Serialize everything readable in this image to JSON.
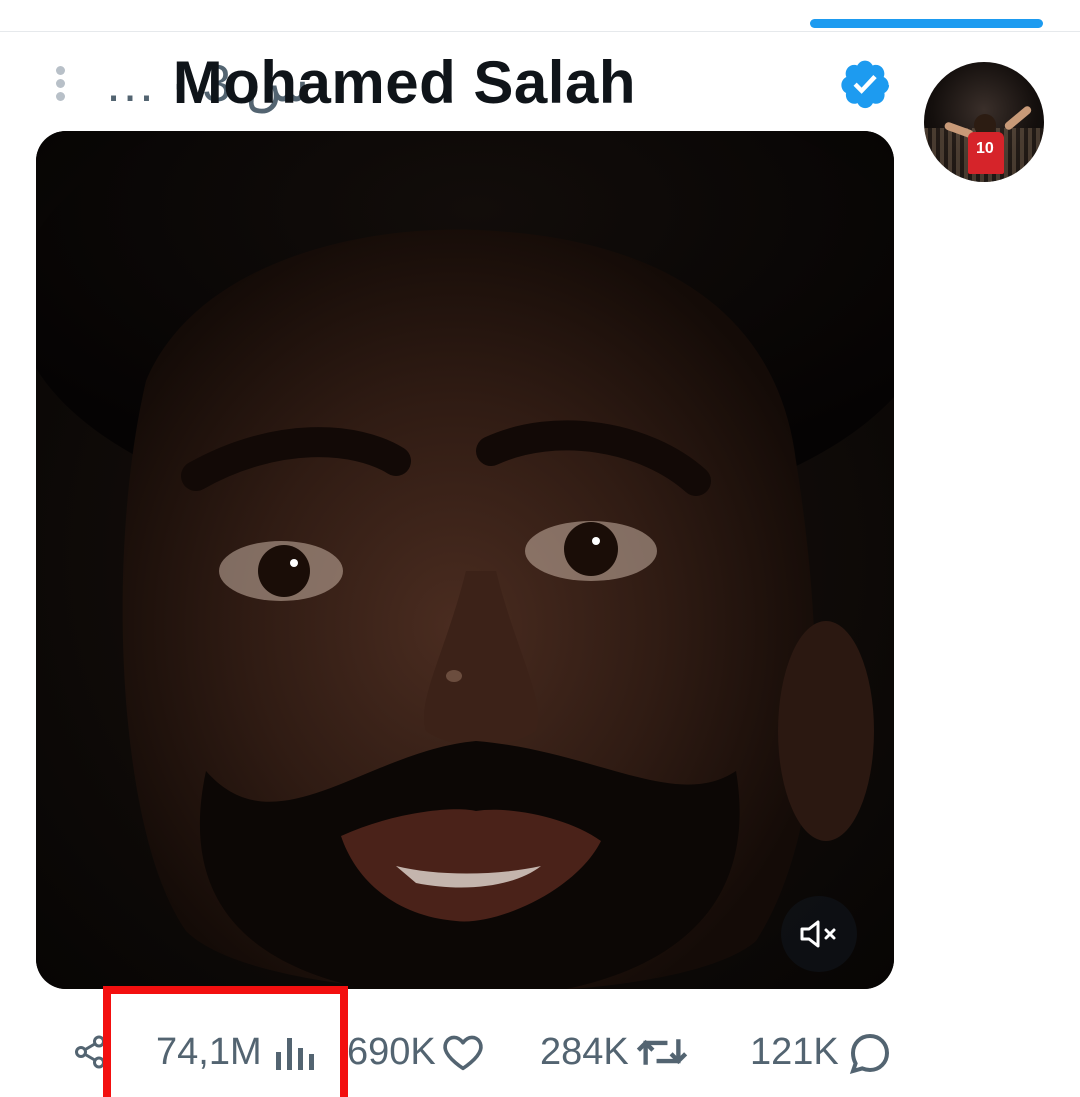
{
  "post": {
    "author_name": "Mohamed Salah",
    "time_meta": "… · 3 س",
    "verified": true
  },
  "media": {
    "description_icon": "video-still",
    "mute_icon": "speaker-muted-icon"
  },
  "actions": {
    "views": "74,1M",
    "likes": "690K",
    "reposts": "284K",
    "replies": "121K"
  },
  "colors": {
    "accent": "#1d9bf0",
    "muted_text": "#536471",
    "highlight": "#f30f0f"
  }
}
